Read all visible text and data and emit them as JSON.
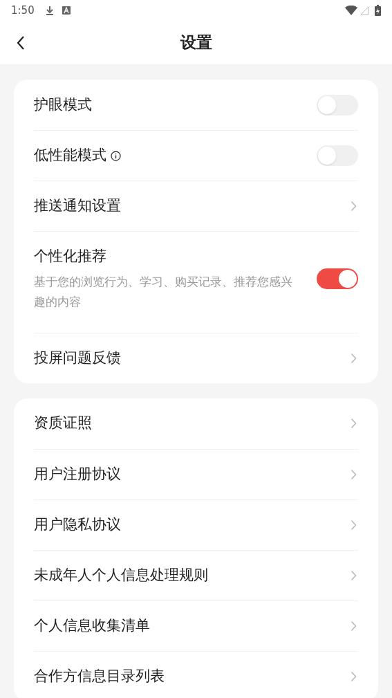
{
  "status_bar": {
    "time": "1:50"
  },
  "header": {
    "title": "设置"
  },
  "groups": [
    {
      "items": [
        {
          "kind": "toggle",
          "label": "护眼模式",
          "on": false
        },
        {
          "kind": "toggle",
          "label": "低性能模式",
          "info": true,
          "on": false
        },
        {
          "kind": "link",
          "label": "推送通知设置"
        },
        {
          "kind": "toggle",
          "label": "个性化推荐",
          "description": "基于您的浏览行为、学习、购买记录、推荐您感兴趣的内容",
          "on": true
        },
        {
          "kind": "link",
          "label": "投屏问题反馈"
        }
      ]
    },
    {
      "items": [
        {
          "kind": "link",
          "label": "资质证照"
        },
        {
          "kind": "link",
          "label": "用户注册协议"
        },
        {
          "kind": "link",
          "label": "用户隐私协议"
        },
        {
          "kind": "link",
          "label": "未成年人个人信息处理规则"
        },
        {
          "kind": "link",
          "label": "个人信息收集清单"
        },
        {
          "kind": "link",
          "label": "合作方信息目录列表"
        }
      ]
    }
  ]
}
